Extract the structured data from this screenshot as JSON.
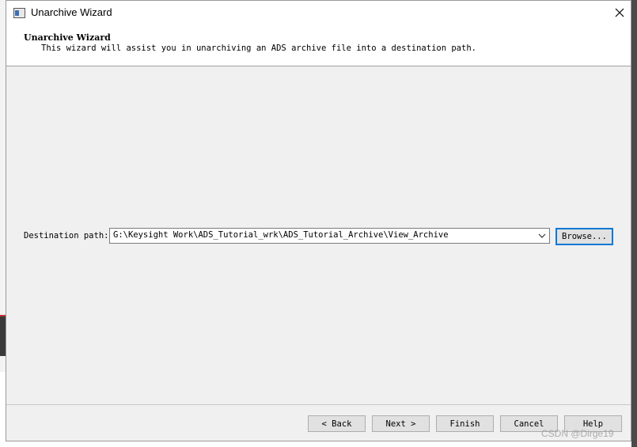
{
  "window": {
    "title": "Unarchive Wizard",
    "app_icon": "window-icon",
    "close_icon": "close-icon"
  },
  "header": {
    "title": "Unarchive Wizard",
    "description": "This wizard will assist you in unarchiving an ADS archive file into a destination path."
  },
  "destination": {
    "label": "Destination path:",
    "value": "G:\\Keysight Work\\ADS_Tutorial_wrk\\ADS_Tutorial_Archive\\View_Archive",
    "browse_label": "Browse..."
  },
  "footer": {
    "back_label": "< Back",
    "next_label": "Next >",
    "finish_label": "Finish",
    "cancel_label": "Cancel",
    "help_label": "Help"
  },
  "watermark": "CSDN @Dirge19",
  "colors": {
    "dialog_bg": "#f0f0f0",
    "focus_border": "#0078d7"
  }
}
